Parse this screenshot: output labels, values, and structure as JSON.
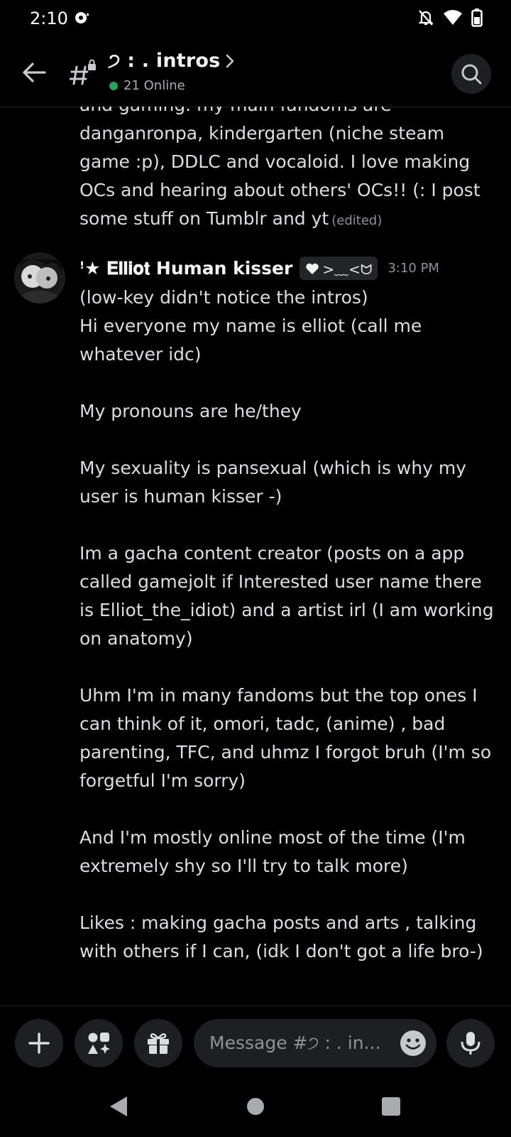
{
  "status_bar": {
    "time": "2:10"
  },
  "header": {
    "channel_name": "੭ :  . intros",
    "online_count": "21 Online"
  },
  "previous_message": {
    "lines": "and gaming. my main fandoms are danganronpa, kindergarten (niche steam game :p), DDLC and vocaloid. I love making OCs and hearing about others' OCs!! (: I post some stuff on Tumblr and yt",
    "edited_label": "(edited)"
  },
  "message": {
    "username": "ꜝ★ 𝐄𝐥𝐥𝐢𝐨𝐭 Human kisser",
    "tag": ">﹏<ᗢ",
    "timestamp": "3:10 PM",
    "paragraphs": [
      "(low-key didn't notice the intros)",
      "Hi everyone my name is elliot (call me whatever idc)",
      "My pronouns are he/they",
      "My sexuality is pansexual (which is why my user is human kisser -)",
      "Im a gacha content creator (posts on a app called gamejolt if Interested user name there is Elliot_the_idiot) and a artist irl (I am working on anatomy)",
      "Uhm I'm in many fandoms but the top ones I can think of it, omori, tadc, (anime) , bad parenting, TFC,   and uhmz I forgot bruh (I'm so forgetful I'm sorry)",
      "And I'm mostly online most of the time (I'm extremely shy so I'll try to talk more)",
      "Likes : making gacha posts and arts , talking with others if I can, (idk I don't got a life bro-)"
    ]
  },
  "composer": {
    "placeholder": "Message #੭ :  . in..."
  },
  "colors": {
    "background": "#000000",
    "accent_online": "#23a55a",
    "button_bg": "#1e1f22"
  }
}
